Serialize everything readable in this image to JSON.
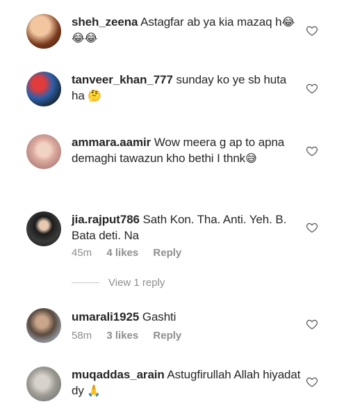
{
  "comments": [
    {
      "username": "sheh_zeena",
      "text": "Astagfar ab ya kia mazaq h",
      "emoji": "😂😂😂"
    },
    {
      "username": "tanveer_khan_777",
      "text": "sunday ko ye sb huta ha",
      "emoji": "🤔"
    },
    {
      "username": "ammara.aamir",
      "text": "Wow meera g ap to apna demaghi tawazun kho bethi I thnk",
      "emoji": "😅"
    },
    {
      "username": "jia.rajput786",
      "text": "Sath Kon. Tha. Anti. Yeh. B. Bata deti. Na",
      "time": "45m",
      "likes": "4 likes",
      "reply": "Reply",
      "view_replies": "View 1 reply"
    },
    {
      "username": "umarali1925",
      "text": "Gashti",
      "time": "58m",
      "likes": "3 likes",
      "reply": "Reply"
    },
    {
      "username": "muqaddas_arain",
      "text": "Astugfirullah Allah hiyadat dy",
      "emoji": "🙏"
    }
  ],
  "icons": {
    "heart": "heart-outline-icon"
  },
  "colors": {
    "text": "#262626",
    "muted": "#8e8e8e"
  }
}
